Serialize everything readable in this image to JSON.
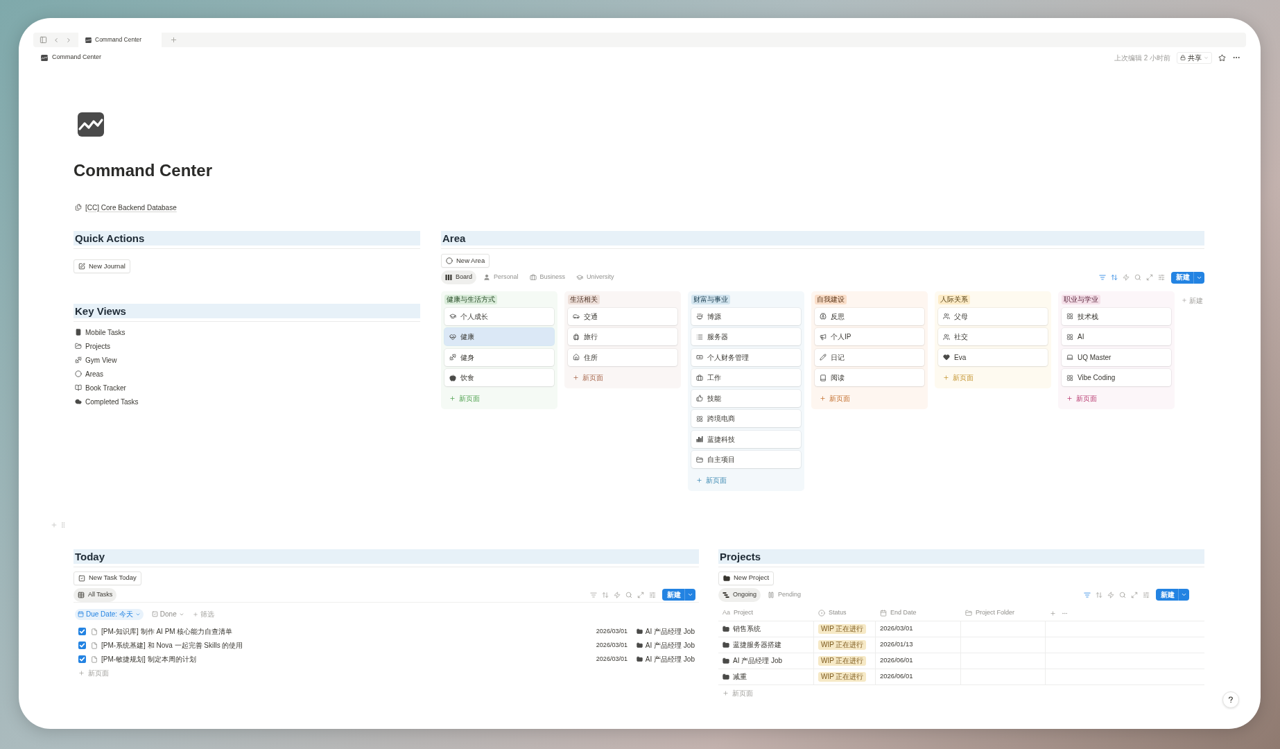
{
  "browser_tabs": [
    {
      "title": "Command Center",
      "selected": true
    }
  ],
  "breadcrumb": "Command Center",
  "last_edited": "上次编辑 2 小时前",
  "share_button": "共享",
  "page": {
    "title": "Command Center",
    "linked_database": "[CC] Core Backend Database"
  },
  "quick_actions": {
    "heading": "Quick Actions",
    "buttons": [
      "New Journal"
    ]
  },
  "key_views": {
    "heading": "Key Views",
    "items": [
      "Mobile Tasks",
      "Projects",
      "Gym View",
      "Areas",
      "Book Tracker",
      "Completed Tasks"
    ]
  },
  "area": {
    "heading": "Area",
    "new_button": "New Area",
    "views": [
      {
        "label": "Board",
        "selected": true
      },
      {
        "label": "Personal",
        "selected": false
      },
      {
        "label": "Business",
        "selected": false
      },
      {
        "label": "University",
        "selected": false
      }
    ],
    "toolbar": {
      "filter_active": true,
      "sort_active": true,
      "new_button": "新建"
    },
    "columns": [
      {
        "title": "健康与生活方式",
        "color": "#dbeddb",
        "cards": [
          {
            "title": "个人成长",
            "selected": false
          },
          {
            "title": "健康",
            "selected": true
          },
          {
            "title": "健身",
            "selected": false
          },
          {
            "title": "饮食",
            "selected": false
          }
        ],
        "add_label": "新页面"
      },
      {
        "title": "生活相关",
        "color": "#eee0da",
        "cards": [
          {
            "title": "交通",
            "selected": false
          },
          {
            "title": "旅行",
            "selected": false
          },
          {
            "title": "住所",
            "selected": false
          }
        ],
        "add_label": "新页面"
      },
      {
        "title": "财富与事业",
        "color": "#d3e5ef",
        "cards": [
          {
            "title": "博源",
            "selected": false
          },
          {
            "title": "服务器",
            "selected": false
          },
          {
            "title": "个人财务管理",
            "selected": false
          },
          {
            "title": "工作",
            "selected": false
          },
          {
            "title": "技能",
            "selected": false
          },
          {
            "title": "跨境电商",
            "selected": false
          },
          {
            "title": "蓝捷科技",
            "selected": false
          },
          {
            "title": "自主项目",
            "selected": false
          }
        ],
        "add_label": "新页面"
      },
      {
        "title": "自我建设",
        "color": "#fadec9",
        "cards": [
          {
            "title": "反思",
            "selected": false
          },
          {
            "title": "个人IP",
            "selected": false
          },
          {
            "title": "日记",
            "selected": false
          },
          {
            "title": "阅读",
            "selected": false
          }
        ],
        "add_label": "新页面"
      },
      {
        "title": "人际关系",
        "color": "#fdecc8",
        "cards": [
          {
            "title": "父母",
            "selected": false
          },
          {
            "title": "社交",
            "selected": false
          },
          {
            "title": "Eva",
            "selected": false
          }
        ],
        "add_label": "新页面"
      },
      {
        "title": "职业与学业",
        "color": "#f5e0e9",
        "cards": [
          {
            "title": "技术栈",
            "selected": false
          },
          {
            "title": "AI",
            "selected": false
          },
          {
            "title": "UQ Master",
            "selected": false
          },
          {
            "title": "Vibe Coding",
            "selected": false
          }
        ],
        "add_label": "新页面"
      }
    ],
    "add_group": "新建"
  },
  "today": {
    "heading": "Today",
    "new_button": "New Task Today",
    "views": [
      {
        "label": "All Tasks",
        "selected": true
      }
    ],
    "toolbar": {
      "filter_active": false,
      "sort_active": false,
      "new_button": "新建"
    },
    "filters": [
      {
        "label": "Due Date: 今天",
        "active": true
      },
      {
        "label": "Done",
        "active": false
      }
    ],
    "add_filter": "筛选",
    "tasks": [
      {
        "done": true,
        "title": "[PM-知识库] 制作 AI PM 核心能力自查清单",
        "due": "2026/03/01",
        "project": "AI 产品经理 Job"
      },
      {
        "done": true,
        "title": "[PM-系统基建] 和 Nova 一起完善 Skills 的使用",
        "due": "2026/03/01",
        "project": "AI 产品经理 Job"
      },
      {
        "done": true,
        "title": "[PM-敏捷规划] 制定本周的计划",
        "due": "2026/03/01",
        "project": "AI 产品经理 Job"
      }
    ],
    "add_row": "新页面"
  },
  "projects": {
    "heading": "Projects",
    "new_button": "New Project",
    "views": [
      {
        "label": "Ongoing",
        "selected": true
      },
      {
        "label": "Pending",
        "selected": false
      }
    ],
    "toolbar": {
      "filter_active": true,
      "sort_active": false,
      "new_button": "新建"
    },
    "columns": [
      {
        "kind": "title",
        "glyph": "Aa",
        "label": "Project"
      },
      {
        "kind": "status",
        "label": "Status"
      },
      {
        "kind": "date",
        "label": "End Date"
      },
      {
        "kind": "folder",
        "label": "Project Folder"
      }
    ],
    "rows": [
      {
        "name": "销售系统",
        "status": "WIP 正在进行",
        "end_date": "2026/03/01"
      },
      {
        "name": "蓝捷服务器搭建",
        "status": "WIP 正在进行",
        "end_date": "2026/01/13"
      },
      {
        "name": "AI 产品经理 Job",
        "status": "WIP 正在进行",
        "end_date": "2026/06/01"
      },
      {
        "name": "减重",
        "status": "WIP 正在进行",
        "end_date": "2026/06/01"
      }
    ],
    "add_row": "新页面"
  }
}
